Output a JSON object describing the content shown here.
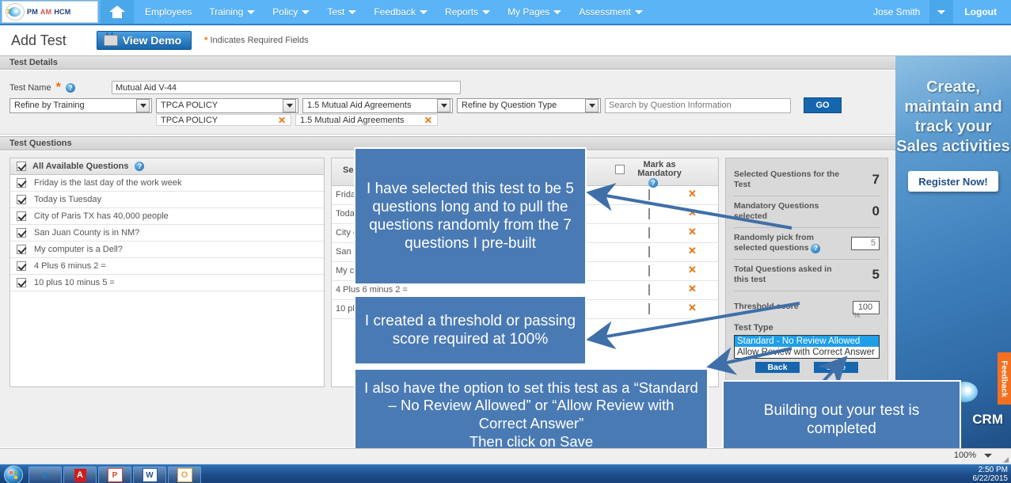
{
  "nav": {
    "logo": {
      "pm": "PM",
      "am": "AM",
      "hcm": "HCM",
      "micro": "Around the world"
    },
    "home_icon": "home-icon",
    "items": [
      {
        "label": "Employees",
        "has_caret": false
      },
      {
        "label": "Training",
        "has_caret": true
      },
      {
        "label": "Policy",
        "has_caret": true
      },
      {
        "label": "Test",
        "has_caret": true
      },
      {
        "label": "Feedback",
        "has_caret": true
      },
      {
        "label": "Reports",
        "has_caret": true
      },
      {
        "label": "My Pages",
        "has_caret": true
      },
      {
        "label": "Assessment",
        "has_caret": true
      }
    ],
    "username": "Jose Smith",
    "logout": "Logout"
  },
  "header": {
    "title": "Add Test",
    "demo_button": "View Demo",
    "required_star": "*",
    "required_note": "Indicates Required Fields"
  },
  "sections": {
    "test_details": "Test Details",
    "test_questions": "Test Questions"
  },
  "details": {
    "test_name_label": "Test Name",
    "test_name_value": "Mutual Aid V-44",
    "refine_training": "Refine by Training",
    "policy_select": "TPCA POLICY",
    "agreement_select": "1.5 Mutual Aid Agreements",
    "refine_question_type": "Refine by Question Type",
    "search_placeholder": "Search by Question Information",
    "search_value": "",
    "go_label": "GO",
    "chips": [
      "TPCA POLICY",
      "1.5 Mutual Aid Agreements"
    ]
  },
  "available": {
    "header": "All Available Questions",
    "header_checked": true,
    "items": [
      {
        "text": "Friday is the last day of the work week",
        "checked": true
      },
      {
        "text": "Today is Tuesday",
        "checked": true
      },
      {
        "text": "City of Paris TX has 40,000 people",
        "checked": true
      },
      {
        "text": "San Juan County is in NM?",
        "checked": true
      },
      {
        "text": "My computer is a Dell?",
        "checked": true
      },
      {
        "text": "4 Plus 6 minus 2 =",
        "checked": true
      },
      {
        "text": "10 plus 10 minus 5 =",
        "checked": true
      }
    ]
  },
  "selected": {
    "header": "Selected Questions",
    "mandatory_header": "Mark as Mandatory",
    "mandatory_header_checked": false,
    "rows": [
      {
        "text": "Friday is the last day of the work week",
        "mandatory": false,
        "remove": "✕"
      },
      {
        "text": "Today is Tuesday",
        "mandatory": false,
        "remove": "✕"
      },
      {
        "text": "City of Paris TX has 40,000 people",
        "mandatory": false,
        "remove": "✕"
      },
      {
        "text": "San Juan County is in NM?",
        "mandatory": false,
        "remove": "✕"
      },
      {
        "text": "My computer is a Dell?",
        "mandatory": false,
        "remove": "✕"
      },
      {
        "text": "4 Plus 6 minus 2 =",
        "mandatory": false,
        "remove": "✕"
      },
      {
        "text": "10 plus 10 minus 5 =",
        "mandatory": false,
        "remove": "✕"
      }
    ]
  },
  "summary": {
    "selected_questions_label": "Selected Questions for the Test",
    "selected_questions_value": "7",
    "mandatory_label": "Mandatory Questions selected",
    "mandatory_value": "0",
    "random_label": "Randomly pick from selected questions",
    "random_value": "5",
    "total_label": "Total Questions asked in this test",
    "total_value": "5",
    "threshold_label": "Threshold score",
    "threshold_value": "100",
    "threshold_unit": "%",
    "test_type_label": "Test Type",
    "test_type_options": [
      "Standard - No Review Allowed",
      "Allow Review with Correct Answer"
    ],
    "test_type_selected": "Standard - No Review Allowed",
    "back_label": "Back",
    "save_label": "Save"
  },
  "ad": {
    "title": "Create, maintain and track your Sales activities",
    "button": "Register Now!",
    "brand": "CRM",
    "feedback_tab": "Feedback"
  },
  "callouts": {
    "one": "I have selected this test to be 5 questions long and to pull the questions randomly from the 7 questions I pre-built",
    "two": "I created a threshold or passing score required at 100%",
    "three": "I also have the option to set this test as a “Standard – No Review Allowed” or “Allow Review with Correct Answer”\nThen click on Save",
    "four": "Building out your test is completed"
  },
  "browser": {
    "zoom_level": "100%"
  },
  "taskbar": {
    "start": "start-orb",
    "buttons": [
      "internet-explorer",
      "adobe-reader",
      "powerpoint",
      "word",
      "outlook"
    ],
    "time": "2:50 PM",
    "date": "6/22/2015"
  },
  "colors": {
    "nav_blue": "#5bb4f5",
    "callout_blue": "#4a7ab4",
    "accent_orange": "#e8720b",
    "button_blue": "#1566ad",
    "feedback_orange": "#f37021"
  }
}
